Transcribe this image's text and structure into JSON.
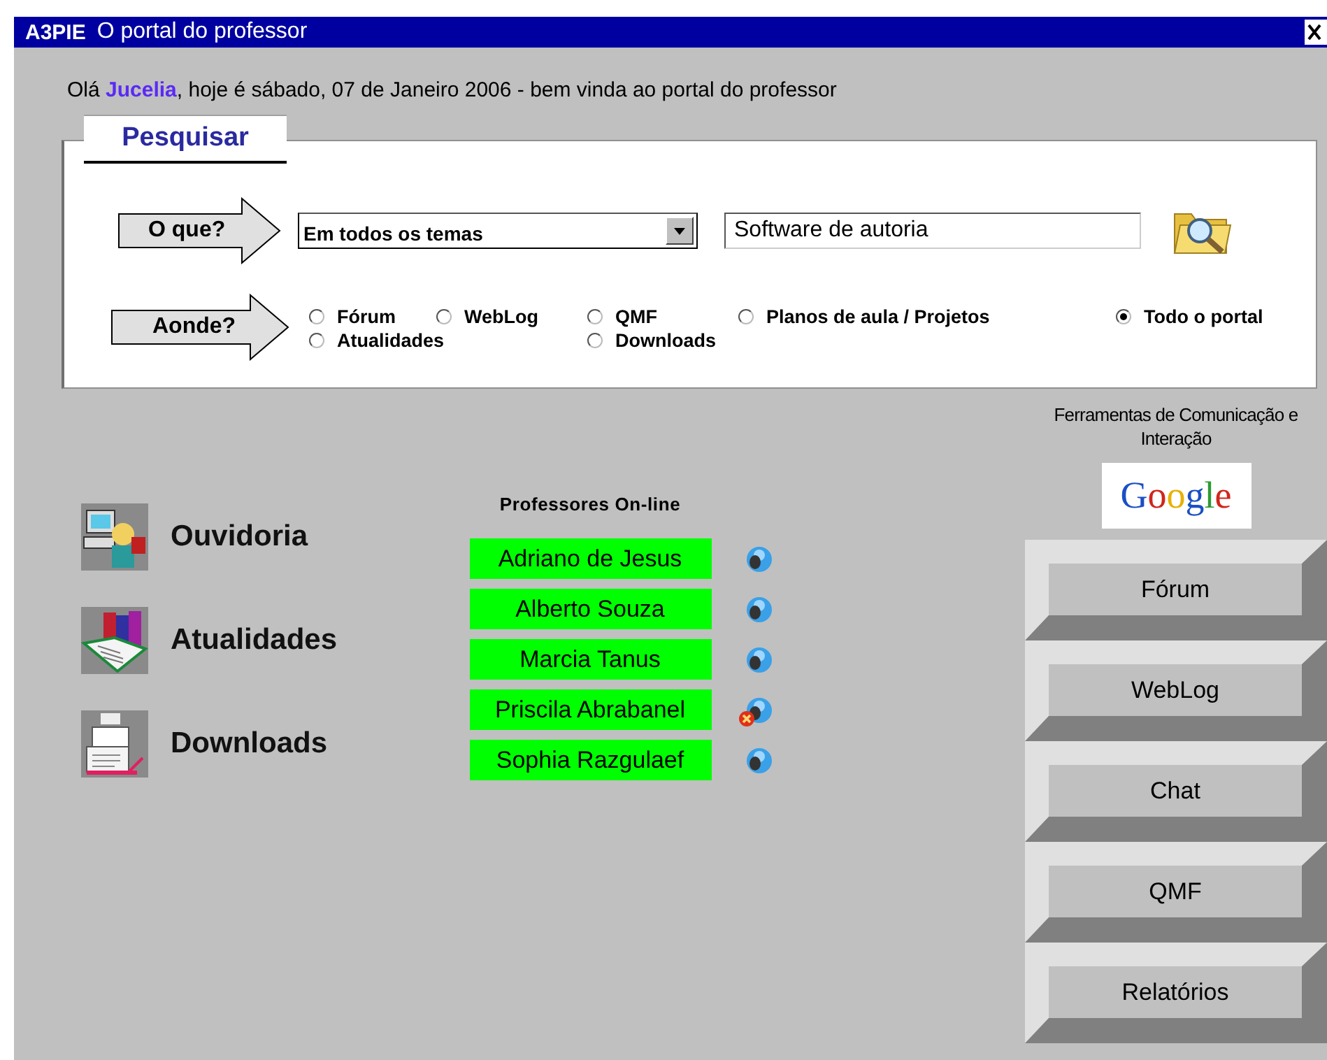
{
  "window": {
    "title_app": "A3PIE",
    "title": "O portal do professor"
  },
  "greeting": "Olá **Jucelia**, hoje é sábado, 07 de Janeiro 2006 - bem vinda ao portal do professor",
  "search": {
    "legend": "Pesquisar",
    "what_label": "O que?",
    "topic_select": "Em todos os temas",
    "query": "Software de autoria",
    "where_label": "Aonde?",
    "scopes": [
      {
        "label": "Fórum",
        "selected": false
      },
      {
        "label": "WebLog",
        "selected": false
      },
      {
        "label": "QMF",
        "selected": false
      },
      {
        "label": "Planos de aula / Projetos",
        "selected": false
      },
      {
        "label": "Todo o portal",
        "selected": true
      },
      {
        "label": "Atualidades",
        "selected": false
      },
      {
        "label": "Downloads",
        "selected": false
      }
    ]
  },
  "sections": [
    {
      "kind": "ombudsman",
      "label": "Ouvidoria"
    },
    {
      "kind": "news",
      "label": "Atualidades"
    },
    {
      "kind": "downloads",
      "label": "Downloads"
    }
  ],
  "online": {
    "title": "Professores On-line",
    "teachers": [
      {
        "name": "Adriano de Jesus",
        "blocked": false
      },
      {
        "name": "Alberto Souza",
        "blocked": false
      },
      {
        "name": "Marcia Tanus",
        "blocked": false
      },
      {
        "name": "Priscila Abrabanel",
        "blocked": true
      },
      {
        "name": "Sophia Razgulaef",
        "blocked": false
      }
    ]
  },
  "tools": {
    "title": "Ferramentas de Comunicação e Interação",
    "logo": "Google",
    "buttons": [
      "Fórum",
      "WebLog",
      "Chat",
      "QMF",
      "Relatórios"
    ]
  }
}
